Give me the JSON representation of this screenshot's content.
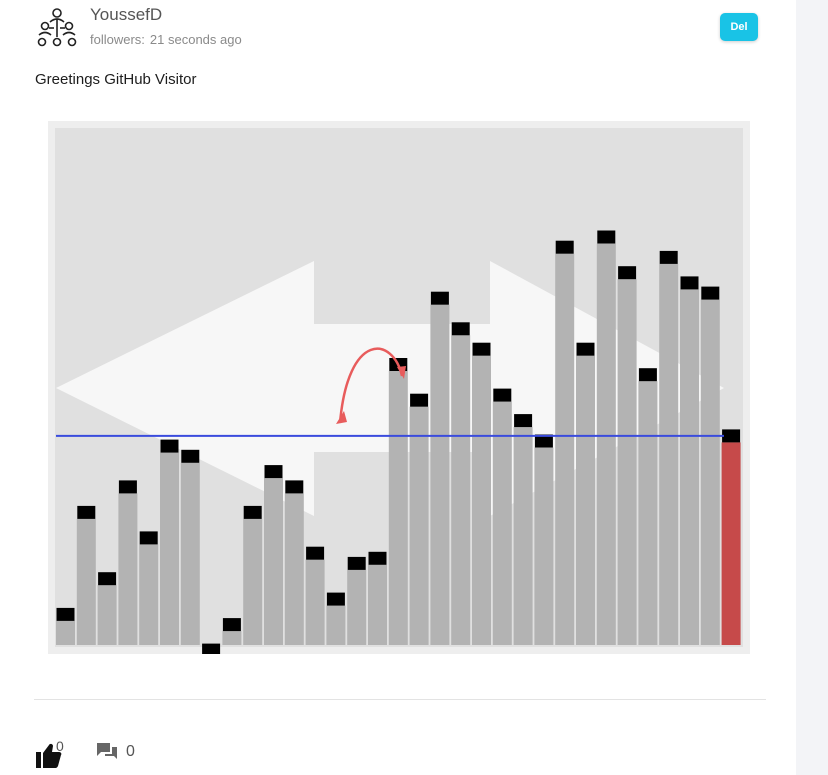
{
  "post": {
    "author": "YoussefD",
    "meta_label": "followers:",
    "timestamp": "21 seconds ago",
    "delete_label": "Del",
    "message": "Greetings GitHub Visitor",
    "likes": "0",
    "comments": "0"
  },
  "icons": {
    "avatar": "org-chart-icon",
    "like": "thumbs-up-icon",
    "comment": "comment-icon"
  },
  "colors": {
    "accent": "#19c3e6",
    "bar": "#b3b3b3",
    "marker": "#000000",
    "highlight_bar": "#c64a4a",
    "reference_line": "#3a4bdd",
    "arrow": "#e85c5c"
  },
  "chart_data": {
    "type": "bar",
    "ylim": [
      0,
      100
    ],
    "values": [
      6,
      26,
      13,
      31,
      21,
      39,
      37,
      -1,
      4,
      26,
      34,
      31,
      18,
      9,
      16,
      17,
      55,
      48,
      68,
      62,
      58,
      49,
      44,
      40,
      78,
      58,
      80,
      73,
      53,
      76,
      71,
      69,
      41
    ],
    "highlight_index": 32,
    "reference_value": 41
  }
}
